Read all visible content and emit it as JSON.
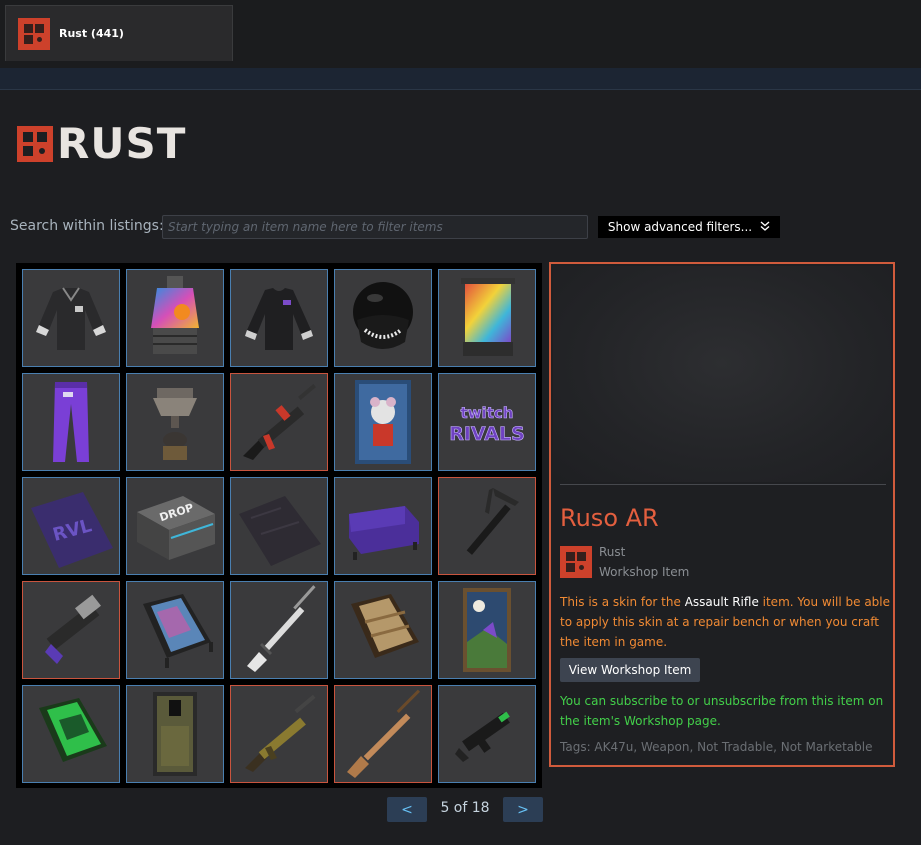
{
  "tab": {
    "label": "Rust (441)"
  },
  "logo": {
    "text": "RUST"
  },
  "search": {
    "label": "Search within listings:",
    "placeholder": "Start typing an item name here to filter items",
    "value": ""
  },
  "advanced_filters": {
    "label": "Show advanced filters...",
    "icon": "double-chevron-down-icon"
  },
  "grid": {
    "items": [
      {
        "icon": "hoodie-icon"
      },
      {
        "icon": "furnace-icon"
      },
      {
        "icon": "tshirt-icon"
      },
      {
        "icon": "helmet-icon"
      },
      {
        "icon": "banner-icon"
      },
      {
        "icon": "pants-icon"
      },
      {
        "icon": "trophy-icon"
      },
      {
        "icon": "rifle-icon"
      },
      {
        "icon": "poster-icon"
      },
      {
        "icon": "twitch-rivals-logo-icon"
      },
      {
        "icon": "rug-icon"
      },
      {
        "icon": "drop-box-icon"
      },
      {
        "icon": "tarp-icon"
      },
      {
        "icon": "sofa-icon"
      },
      {
        "icon": "pickaxe-icon"
      },
      {
        "icon": "launcher-icon"
      },
      {
        "icon": "bed-icon"
      },
      {
        "icon": "hunting-rifle-icon"
      },
      {
        "icon": "bed-icon"
      },
      {
        "icon": "painting-icon"
      },
      {
        "icon": "bed-icon"
      },
      {
        "icon": "locker-icon"
      },
      {
        "icon": "rifle-icon"
      },
      {
        "icon": "bolt-rifle-icon"
      },
      {
        "icon": "smg-icon"
      }
    ]
  },
  "pager": {
    "prev": "<",
    "next": ">",
    "text": "5 of 18"
  },
  "detail": {
    "name": "Ruso AR",
    "game": "Rust",
    "type": "Workshop Item",
    "desc_pre": "This is a skin for the ",
    "desc_item": "Assault Rifle",
    "desc_post": " item. You will be able to apply this skin at a repair bench or when you craft the item in game.",
    "button": "View Workshop Item",
    "subscribe": "You can subscribe to or unsubscribe from this item on the item's Workshop page.",
    "tags": "Tags: AK47u, Weapon, Not Tradable, Not Marketable"
  },
  "colors": {
    "accent": "#e35f3f",
    "selected_border": "#c9543e",
    "item_border": "#4a7fb0",
    "orange_text": "#f08a34",
    "green_text": "#43d04a"
  }
}
